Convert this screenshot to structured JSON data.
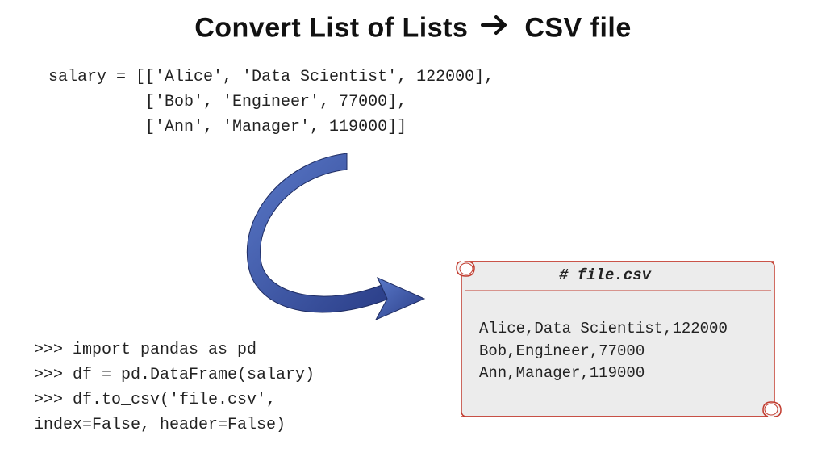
{
  "title": {
    "left": "Convert List of Lists",
    "right": "CSV file"
  },
  "code_top": "salary = [['Alice', 'Data Scientist', 122000],\n          ['Bob', 'Engineer', 77000],\n          ['Ann', 'Manager', 119000]]",
  "code_bottom": ">>> import pandas as pd\n>>> df = pd.DataFrame(salary)\n>>> df.to_csv('file.csv',\nindex=False, header=False)",
  "file": {
    "name_comment": "# file.csv",
    "content": "Alice,Data Scientist,122000\nBob,Engineer,77000\nAnn,Manager,119000"
  }
}
